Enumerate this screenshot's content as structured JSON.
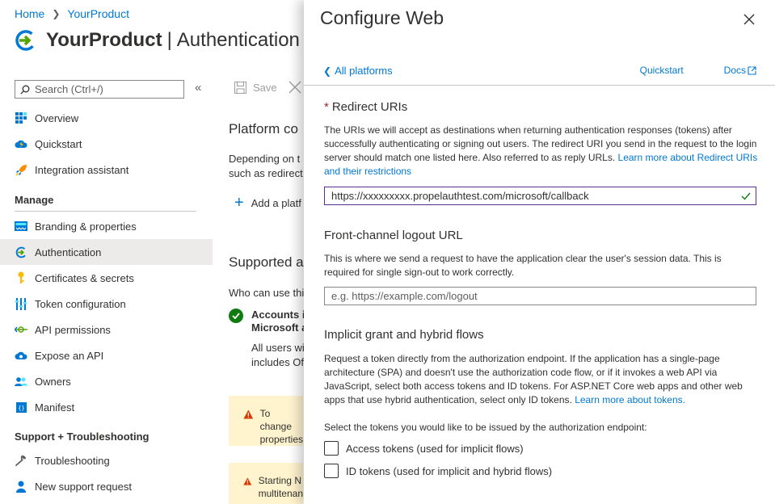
{
  "breadcrumb": {
    "home": "Home",
    "product": "YourProduct"
  },
  "header": {
    "product": "YourProduct",
    "separator": "|",
    "page": "Authentication"
  },
  "search": {
    "placeholder": "Search (Ctrl+/)",
    "collapse": "«"
  },
  "sidebar": {
    "items_top": [
      {
        "label": "Overview",
        "icon": "grid-icon"
      },
      {
        "label": "Quickstart",
        "icon": "cloud-icon"
      },
      {
        "label": "Integration assistant",
        "icon": "rocket-icon"
      }
    ],
    "manage_header": "Manage",
    "manage_items": [
      {
        "label": "Branding & properties",
        "icon": "branding-icon"
      },
      {
        "label": "Authentication",
        "icon": "auth-icon",
        "active": true
      },
      {
        "label": "Certificates & secrets",
        "icon": "key-icon"
      },
      {
        "label": "Token configuration",
        "icon": "token-config-icon"
      },
      {
        "label": "API permissions",
        "icon": "api-permissions-icon"
      },
      {
        "label": "Expose an API",
        "icon": "cloud-api-icon"
      },
      {
        "label": "Owners",
        "icon": "owners-icon"
      },
      {
        "label": "Manifest",
        "icon": "manifest-icon"
      }
    ],
    "support_header": "Support + Troubleshooting",
    "support_items": [
      {
        "label": "Troubleshooting",
        "icon": "wrench-icon"
      },
      {
        "label": "New support request",
        "icon": "person-support-icon"
      }
    ]
  },
  "toolbar": {
    "save_label": "Save"
  },
  "main": {
    "platform_heading": "Platform co",
    "platform_desc_1": "Depending on t",
    "platform_desc_2": "such as redirect",
    "add_platform": "Add a platf",
    "supported_heading": "Supported a",
    "who_can_use": "Who can use thi",
    "account_1": "Accounts i",
    "account_2": "Microsoft a",
    "account_sub_1": "All users wi",
    "account_sub_2": "includes Of",
    "warning_1_line1": "To change",
    "warning_1_line2": "properties",
    "warning_2_line1": "Starting N",
    "warning_2_line2": "multitenan"
  },
  "panel": {
    "title": "Configure Web",
    "back_link": "All platforms",
    "quickstart_link": "Quickstart",
    "docs_link": "Docs",
    "redirect": {
      "required_mark": "*",
      "heading": "Redirect URIs",
      "desc": "The URIs we will accept as destinations when returning authentication responses (tokens) after successfully authenticating or signing out users. The redirect URI you send in the request to the login server should match one listed here. Also referred to as reply URLs.",
      "learn_more": "Learn more about Redirect URIs and their restrictions",
      "value": "https://xxxxxxxxx.propelauthtest.com/microsoft/callback"
    },
    "logout": {
      "heading": "Front-channel logout URL",
      "desc": "This is where we send a request to have the application clear the user's session data. This is required for single sign-out to work correctly.",
      "placeholder": "e.g. https://example.com/logout"
    },
    "implicit": {
      "heading": "Implicit grant and hybrid flows",
      "desc": "Request a token directly from the authorization endpoint. If the application has a single-page architecture (SPA) and doesn't use the authorization code flow, or if it invokes a web API via JavaScript, select both access tokens and ID tokens. For ASP.NET Core web apps and other web apps that use hybrid authentication, select only ID tokens.",
      "learn_more": "Learn more about tokens.",
      "select_prompt": "Select the tokens you would like to be issued by the authorization endpoint:",
      "access_tokens": "Access tokens (used for implicit flows)",
      "id_tokens": "ID tokens (used for implicit and hybrid flows)",
      "access_checked": false,
      "id_checked": false
    }
  },
  "colors": {
    "accent": "#0078d4",
    "required": "#a4262c",
    "success": "#107c10",
    "warning_bg": "#fff4ce"
  }
}
